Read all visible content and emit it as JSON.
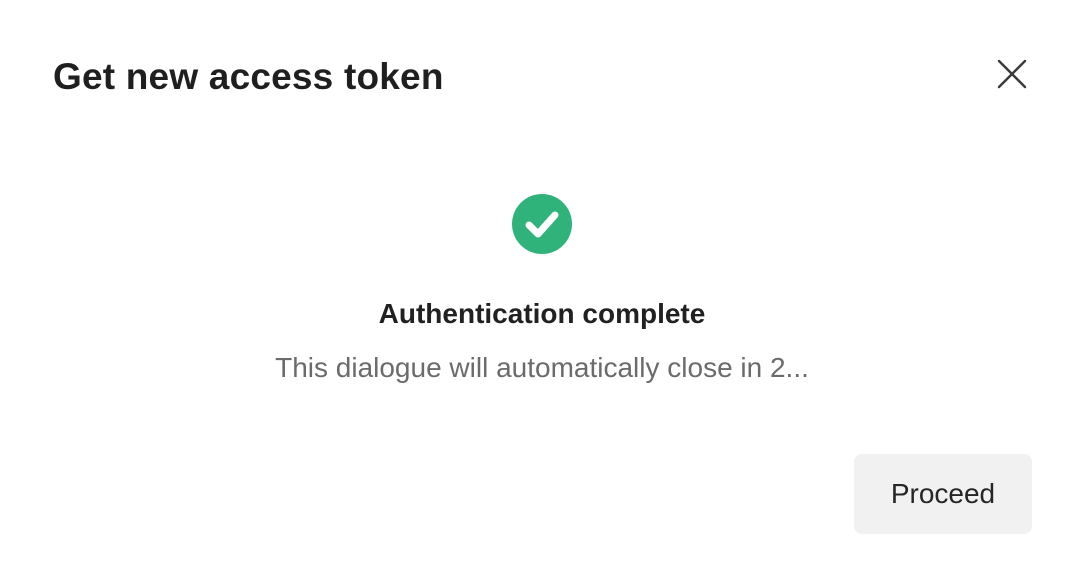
{
  "dialog": {
    "title": "Get new access token",
    "close_icon": "close-icon",
    "status_icon": "check-circle-icon",
    "headline": "Authentication complete",
    "message": "This dialogue will automatically close in 2...",
    "proceed_label": "Proceed"
  },
  "colors": {
    "success": "#2fb37b",
    "button_bg": "#f1f1f1",
    "title_text": "#1f1f1f",
    "secondary_text": "#6b6b6b"
  }
}
